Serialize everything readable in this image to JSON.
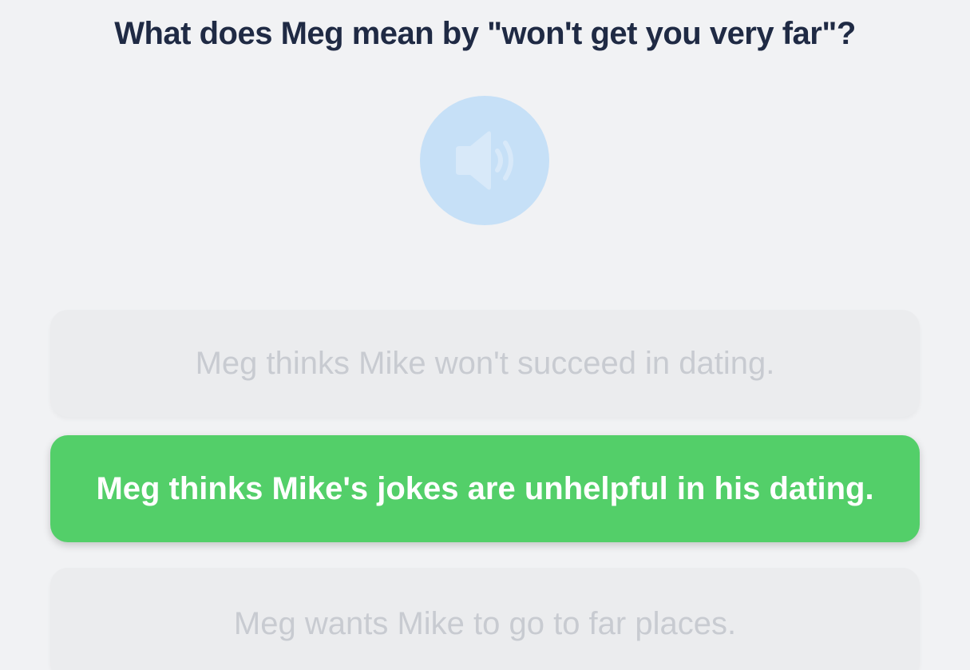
{
  "question": {
    "text": "What does Meg mean by \"won't get you very far\"?"
  },
  "audio": {
    "icon": "speaker-icon",
    "color": "#c6e0f7"
  },
  "options": [
    {
      "label": "Meg thinks Mike won't succeed in dating.",
      "state": "dim"
    },
    {
      "label": "Meg thinks Mike's jokes are unhelpful in his dating.",
      "state": "selected"
    },
    {
      "label": "Meg wants Mike to go to far places.",
      "state": "dim"
    }
  ],
  "colors": {
    "background": "#f1f2f4",
    "question_text": "#1f2a44",
    "selected": "#53cf69",
    "dim_text": "#c8cbd1"
  }
}
